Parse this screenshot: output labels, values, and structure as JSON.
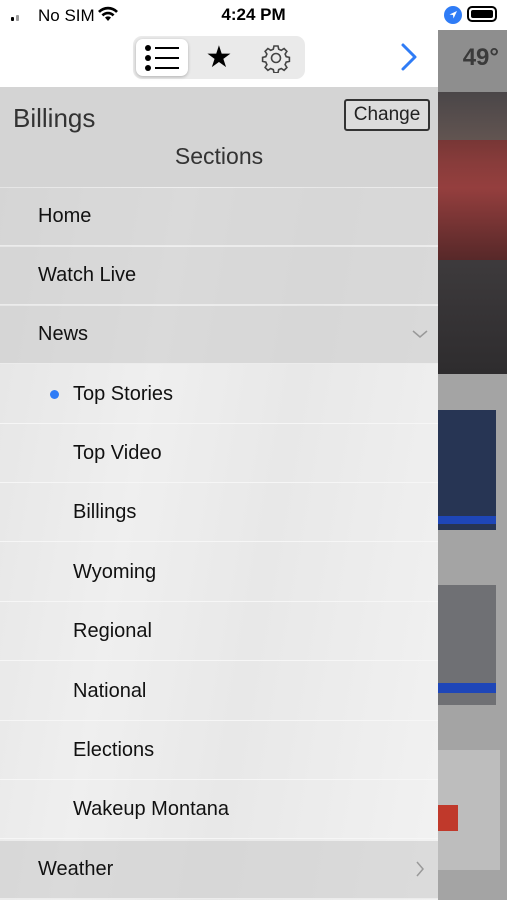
{
  "status_bar": {
    "carrier": "No SIM",
    "time": "4:24 PM"
  },
  "background": {
    "temperature": "49°"
  },
  "drawer": {
    "market": "Billings",
    "change_label": "Change",
    "sections_title": "Sections",
    "items": [
      {
        "label": "Home"
      },
      {
        "label": "Watch Live"
      },
      {
        "label": "News"
      },
      {
        "label": "Top Stories"
      },
      {
        "label": "Top Video"
      },
      {
        "label": "Billings"
      },
      {
        "label": "Wyoming"
      },
      {
        "label": "Regional"
      },
      {
        "label": "National"
      },
      {
        "label": "Elections"
      },
      {
        "label": "Wakeup Montana"
      },
      {
        "label": "Weather"
      }
    ]
  },
  "colors": {
    "accent": "#2f7cf6"
  }
}
